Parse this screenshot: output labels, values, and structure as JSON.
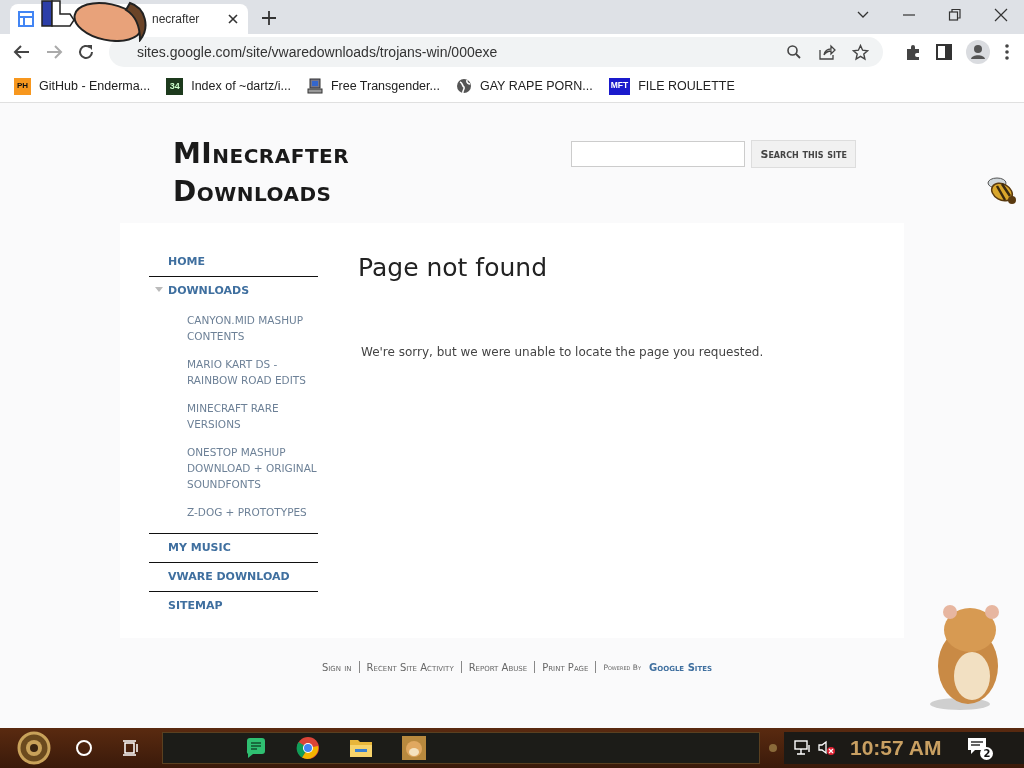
{
  "browser": {
    "tabs": [
      {
        "title": "necrafter",
        "selected": true
      }
    ],
    "address": "sites.google.com/site/vwaredownloads/trojans-win/000exe",
    "bookmarks": [
      {
        "label": "GitHub - Enderma...",
        "kind": "badge",
        "icon_text": "PH"
      },
      {
        "label": "Index of ~dartz/i...",
        "kind": "dark-badge",
        "icon_text": "34"
      },
      {
        "label": "Free Transgender...",
        "kind": "computer"
      },
      {
        "label": "GAY RAPE PORN...",
        "kind": "globe"
      },
      {
        "label": "FILE ROULETTE",
        "kind": "blue-badge",
        "icon_text": "MFT"
      }
    ]
  },
  "site": {
    "title_lines": [
      "MInecrafter",
      "Downloads"
    ],
    "search": {
      "button": "Search this site"
    },
    "sidebar": {
      "items": [
        {
          "label": "HOME"
        },
        {
          "label": "DOWNLOADS",
          "expanded": true,
          "children": [
            {
              "label": "CANYON.MID MASHUP CONTENTS"
            },
            {
              "label": "MARIO KART DS - RAINBOW ROAD EDITS"
            },
            {
              "label": "MINECRAFT RARE VERSIONS"
            },
            {
              "label": "ONESTOP MASHUP DOWNLOAD + ORIGINAL SOUNDFONTS"
            },
            {
              "label": "Z-DOG + PROTOTYPES"
            }
          ]
        },
        {
          "label": "MY MUSIC"
        },
        {
          "label": "VWARE DOWNLOAD"
        },
        {
          "label": "SITEMAP"
        }
      ]
    },
    "heading": "Page not found",
    "message": "We're sorry, but we were unable to locate the page you requested.",
    "footer": {
      "links": [
        "Sign in",
        "Recent Site Activity",
        "Report Abuse",
        "Print Page"
      ],
      "powered_by": "Powered By",
      "brand": "Google Sites"
    }
  },
  "taskbar": {
    "apps": [
      {
        "kind": "chat"
      },
      {
        "kind": "browser"
      },
      {
        "kind": "folder"
      },
      {
        "kind": "picture"
      }
    ],
    "clock": "10:57 AM",
    "notifications": "2"
  }
}
